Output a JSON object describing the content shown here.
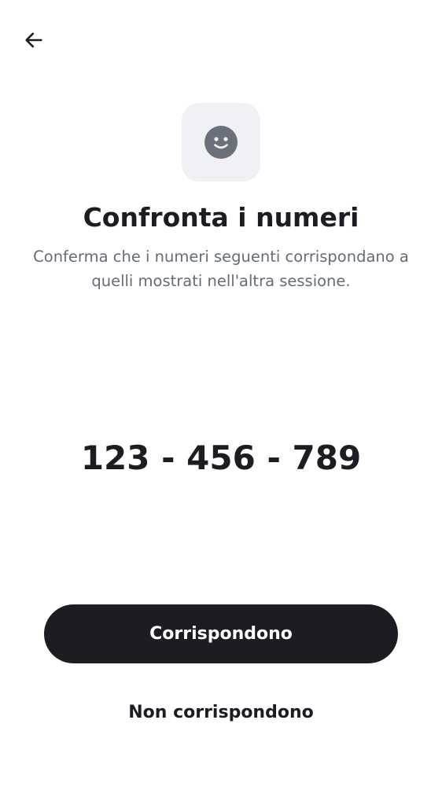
{
  "header": {
    "back_icon": "arrow-left-icon"
  },
  "hero": {
    "icon": "smiley-face-icon",
    "icon_color": "#6b717b",
    "tile_color": "#f0f1f5"
  },
  "content": {
    "title": "Confronta i numeri",
    "subtitle": "Conferma che i numeri seguenti corrispondano a quelli mostrati nell'altra sessione.",
    "code": "123 - 456 - 789"
  },
  "actions": {
    "confirm_label": "Corrispondono",
    "reject_label": "Non corrispondono"
  },
  "colors": {
    "primary": "#1b1d22",
    "secondary_text": "#656c76",
    "background": "#ffffff"
  }
}
